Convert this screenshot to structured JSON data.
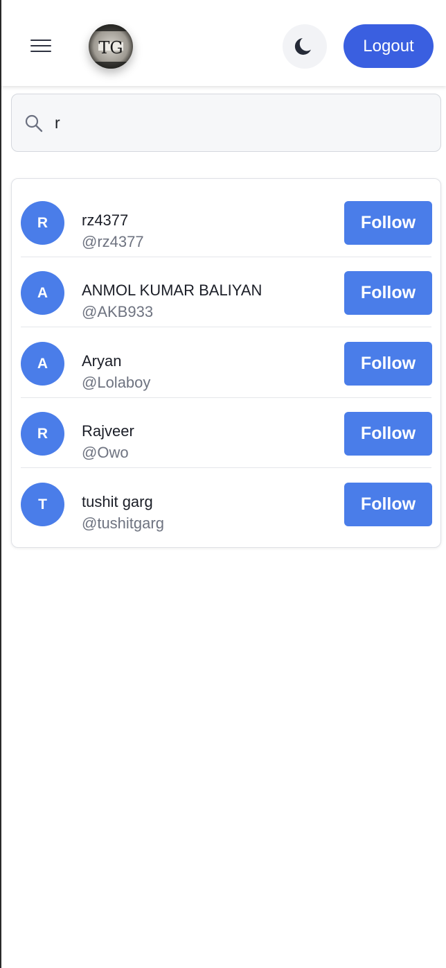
{
  "header": {
    "menu_icon": "hamburger-menu-icon",
    "logo_text": "TG",
    "theme_icon": "moon-icon",
    "logout_label": "Logout"
  },
  "search": {
    "icon": "search-icon",
    "value": "r"
  },
  "users": [
    {
      "initial": "R",
      "name": "rz4377",
      "handle": "@rz4377",
      "follow_label": "Follow"
    },
    {
      "initial": "A",
      "name": "ANMOL KUMAR BALIYAN",
      "handle": "@AKB933",
      "follow_label": "Follow"
    },
    {
      "initial": "A",
      "name": "Aryan",
      "handle": "@Lolaboy",
      "follow_label": "Follow"
    },
    {
      "initial": "R",
      "name": "Rajveer",
      "handle": "@Owo",
      "follow_label": "Follow"
    },
    {
      "initial": "T",
      "name": "tushit garg",
      "handle": "@tushitgarg",
      "follow_label": "Follow"
    }
  ],
  "colors": {
    "accent": "#4a7de9",
    "logout": "#3a5fe0",
    "text_primary": "#1b1e27",
    "text_secondary": "#6e7380"
  }
}
